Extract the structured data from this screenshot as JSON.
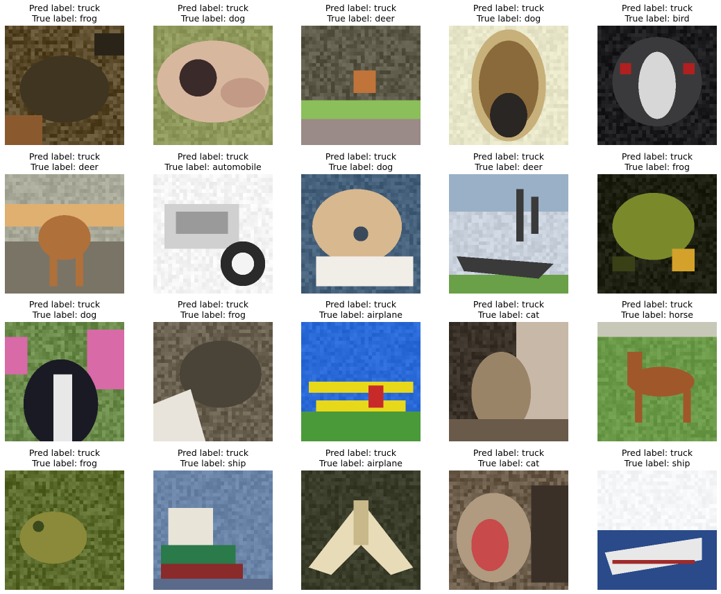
{
  "panels": [
    {
      "pred": "Pred label: truck",
      "true": "True label: frog",
      "scene": "frog-dark",
      "colors": [
        "#5a4a2a",
        "#3f3520",
        "#8a5a2e",
        "#2a2418"
      ]
    },
    {
      "pred": "Pred label: truck",
      "true": "True label: dog",
      "scene": "dog-fluffy",
      "colors": [
        "#8f9a5c",
        "#d8b79f",
        "#3a2a2a",
        "#c29a86"
      ]
    },
    {
      "pred": "Pred label: truck",
      "true": "True label: deer",
      "scene": "deer-field",
      "colors": [
        "#5c5848",
        "#c0743a",
        "#8bbf5a",
        "#9a8a88"
      ]
    },
    {
      "pred": "Pred label: truck",
      "true": "True label: dog",
      "scene": "dog-face",
      "colors": [
        "#e8e6c8",
        "#8a6a3a",
        "#2a2624",
        "#c7b07a"
      ]
    },
    {
      "pred": "Pred label: truck",
      "true": "True label: bird",
      "scene": "bird-emu",
      "colors": [
        "#3a3a3c",
        "#d7d7d7",
        "#b02020",
        "#1c1c1e"
      ]
    },
    {
      "pred": "Pred label: truck",
      "true": "True label: deer",
      "scene": "deer-stand",
      "colors": [
        "#a8a898",
        "#b0703a",
        "#e0b070",
        "#7a7466"
      ]
    },
    {
      "pred": "Pred label: truck",
      "true": "True label: automobile",
      "scene": "car-bw",
      "colors": [
        "#f4f4f4",
        "#2a2a2a",
        "#9a9a9a",
        "#d0d0d0"
      ]
    },
    {
      "pred": "Pred label: truck",
      "true": "True label: dog",
      "scene": "dog-fluffy2",
      "colors": [
        "#45607a",
        "#d8b88f",
        "#f1eee8",
        "#3a4a5a"
      ]
    },
    {
      "pred": "Pred label: truck",
      "true": "True label: deer",
      "scene": "deer-antler",
      "colors": [
        "#9ab0c6",
        "#3a3a3a",
        "#6aa048",
        "#c8d0dc"
      ]
    },
    {
      "pred": "Pred label: truck",
      "true": "True label: frog",
      "scene": "frog-green",
      "colors": [
        "#1c1e10",
        "#7a8a2a",
        "#d4a22a",
        "#3a4016"
      ]
    },
    {
      "pred": "Pred label: truck",
      "true": "True label: dog",
      "scene": "dog-flowers",
      "colors": [
        "#d86aa8",
        "#1a1a24",
        "#e8e8e8",
        "#6a8a4a"
      ]
    },
    {
      "pred": "Pred label: truck",
      "true": "True label: frog",
      "scene": "frog-toad",
      "colors": [
        "#6a6050",
        "#4a4438",
        "#e8e4dc",
        "#8a7e6a"
      ]
    },
    {
      "pred": "Pred label: truck",
      "true": "True label: airplane",
      "scene": "biplane",
      "colors": [
        "#2a6ad8",
        "#e8d81a",
        "#4a9a3a",
        "#c82a2a"
      ]
    },
    {
      "pred": "Pred label: truck",
      "true": "True label: cat",
      "scene": "cat-sit",
      "colors": [
        "#3a3228",
        "#9a8468",
        "#c8b8a8",
        "#6a5a4a"
      ]
    },
    {
      "pred": "Pred label: truck",
      "true": "True label: horse",
      "scene": "horse",
      "colors": [
        "#6a9a48",
        "#a0582a",
        "#c8c8b8",
        "#4a7a34"
      ]
    },
    {
      "pred": "Pred label: truck",
      "true": "True label: frog",
      "scene": "frog-grass",
      "colors": [
        "#5a6a2a",
        "#8a8a3a",
        "#3a4a1c",
        "#a09a4a"
      ]
    },
    {
      "pred": "Pred label: truck",
      "true": "True label: ship",
      "scene": "ship-dock",
      "colors": [
        "#6a84a8",
        "#e8e4d8",
        "#2a7a4a",
        "#8a2a2a"
      ]
    },
    {
      "pred": "Pred label: truck",
      "true": "True label: airplane",
      "scene": "plane-top",
      "colors": [
        "#3a3c2a",
        "#e8dcb8",
        "#5a5a3a",
        "#c8b88a"
      ]
    },
    {
      "pred": "Pred label: truck",
      "true": "True label: cat",
      "scene": "cat-yawn",
      "colors": [
        "#6a5a48",
        "#c84a4a",
        "#3a3028",
        "#b09a80"
      ]
    },
    {
      "pred": "Pred label: truck",
      "true": "True label: ship",
      "scene": "ship-sea",
      "colors": [
        "#f4f6f8",
        "#2a4a8a",
        "#e8e8e8",
        "#a02a2a"
      ]
    }
  ]
}
